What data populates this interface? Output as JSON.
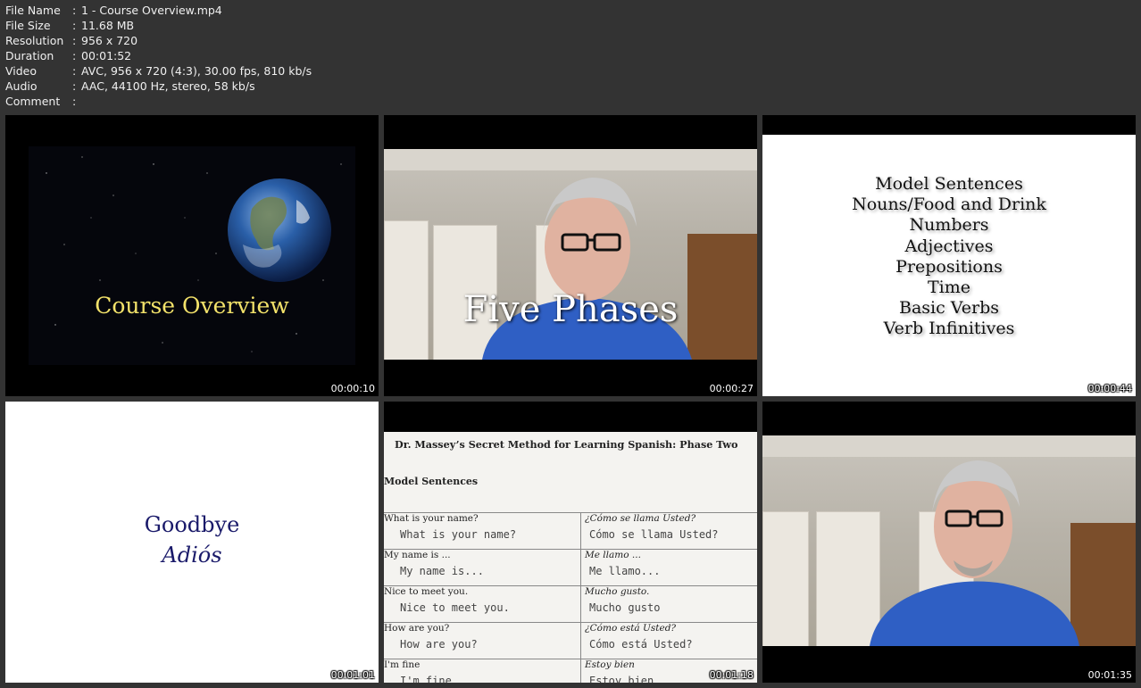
{
  "file_info": [
    {
      "key": "File Name",
      "value": "1 - Course Overview.mp4"
    },
    {
      "key": "File Size",
      "value": "11.68 MB"
    },
    {
      "key": "Resolution",
      "value": "956 x 720"
    },
    {
      "key": "Duration",
      "value": "00:01:52"
    },
    {
      "key": "Video",
      "value": "AVC, 956 x 720 (4:3), 30.00 fps, 810 kb/s"
    },
    {
      "key": "Audio",
      "value": "AAC, 44100 Hz, stereo, 58 kb/s"
    },
    {
      "key": "Comment",
      "value": ""
    }
  ],
  "separator": ":",
  "thumbnails": [
    {
      "timestamp": "00:00:10",
      "title": "Course Overview"
    },
    {
      "timestamp": "00:00:27",
      "title": "Five Phases"
    },
    {
      "timestamp": "00:00:44",
      "lines": [
        "Model Sentences",
        "Nouns/Food and Drink",
        "Numbers",
        "Adjectives",
        "Prepositions",
        "Time",
        "Basic Verbs",
        "Verb Infinitives"
      ]
    },
    {
      "timestamp": "00:01:01",
      "title_en": "Goodbye",
      "title_es": "Adiós"
    },
    {
      "timestamp": "00:01:18",
      "heading": "Dr. Massey’s Secret Method for Learning Spanish: Phase Two",
      "subheading": "Model Sentences",
      "rows": [
        {
          "en": "What is your name?",
          "en_hand": "What is your name?",
          "es": "¿Cómo se llama Usted?",
          "es_hand": "Cómo se llama Usted?"
        },
        {
          "en": "My name is ...",
          "en_hand": "My name is...",
          "es": "Me llamo ...",
          "es_hand": "Me llamo..."
        },
        {
          "en": "Nice to meet you.",
          "en_hand": "Nice to meet you.",
          "es": "Mucho gusto.",
          "es_hand": "Mucho gusto"
        },
        {
          "en": "How are you?",
          "en_hand": "How are you?",
          "es": "¿Cómo está Usted?",
          "es_hand": "Cómo está Usted?"
        },
        {
          "en": "I'm fine",
          "en_hand": "I'm fine",
          "es": "Estoy bien",
          "es_hand": "Estoy bien"
        }
      ]
    },
    {
      "timestamp": "00:01:35"
    }
  ],
  "colors": {
    "background": "#333333",
    "text": "#f0f0f0",
    "gold_title": "#f3e26a",
    "navy_title": "#1a1a6a",
    "shirt_blue": "#2f5fc4"
  }
}
